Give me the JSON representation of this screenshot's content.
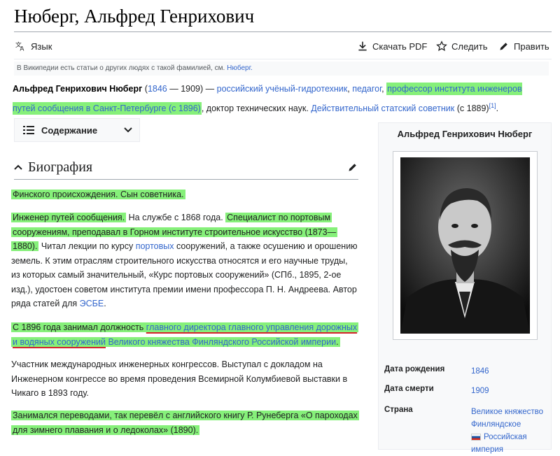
{
  "page": {
    "title": "Нюберг, Альфред Генрихович"
  },
  "toolbar": {
    "language": "Язык",
    "download_pdf": "Скачать PDF",
    "watch": "Следить",
    "edit": "Править"
  },
  "hatnote": {
    "text": "В Википедии есть статьи о других людях с такой фамилией, см. ",
    "link": "Нюберг."
  },
  "lead": {
    "name": "Альфред Генрихович Нюберг",
    "open": " (",
    "birth_year": "1846",
    "dash": " — 1909) — ",
    "role": "российский учёный-гидротехник",
    "comma": ", ",
    "role2": "педагог",
    "comma2": ", ",
    "highlight": "профессор института инженеров путей сообщения в Санкт-Петербурге (с 1896)",
    "rest": ", доктор технических наук. ",
    "rank": "Действительный статский советник",
    "year_rank": " (с 1889)",
    "ref": "[1]",
    "end": "."
  },
  "toc": {
    "label": "Содержание"
  },
  "section": {
    "title": "Биография"
  },
  "paragraphs": {
    "p1": "Финского происхождения. Сын советника.",
    "p2_hl1": "Инженер путей сообщения.",
    "p2_t1": " На службе с 1868 года. ",
    "p2_hl2": "Специалист по портовым сооружениям, преподавал в Горном институте строительное искусство (1873—1880).",
    "p2_t2": " Читал лекции по курсу ",
    "p2_link": "портовых",
    "p2_t3": " сооружений, а также осушению и орошению земель. К этим отраслям строительного искусства относятся и его научные труды, из которых самый значительный, «Курс портовых сооружений» (СПб., 1895, 2-ое изд.), удостоен советом института премии имени профессора П. Н. Андреева. Автор ряда статей для ",
    "p2_link2": "ЭСБЕ",
    "p2_t4": ".",
    "p3_t1": "С 1896 года занимал должность ",
    "p3_t2": "главного директора главного управления дорожных и водяных сооружений",
    "p3_t3": " ",
    "p3_t4": "Великого княжества Финляндского Российской империи",
    "p3_t5": ".",
    "p4": "Участник международных инженерных конгрессов. Выступал с докладом на Инженерном конгрессе во время проведения Всемирной Колумбиевой выставки в Чикаго в 1893 году.",
    "p5": "Занимался переводами, так перевёл с английского книгу Р. Рунеберга «О пароходах для зимнего плавания и о ледоколах» (1890)."
  },
  "infobox": {
    "title": "Альфред Генрихович Нюберг",
    "rows": [
      {
        "label": "Дата рождения",
        "value": "1846"
      },
      {
        "label": "Дата смерти",
        "value": "1909"
      },
      {
        "label": "Страна",
        "value": "Великое княжество Финляндское",
        "value2": "Российская империя"
      }
    ]
  },
  "colors": {
    "highlight": "#86f07a",
    "link": "#3366cc",
    "underline": "#d4232b"
  }
}
